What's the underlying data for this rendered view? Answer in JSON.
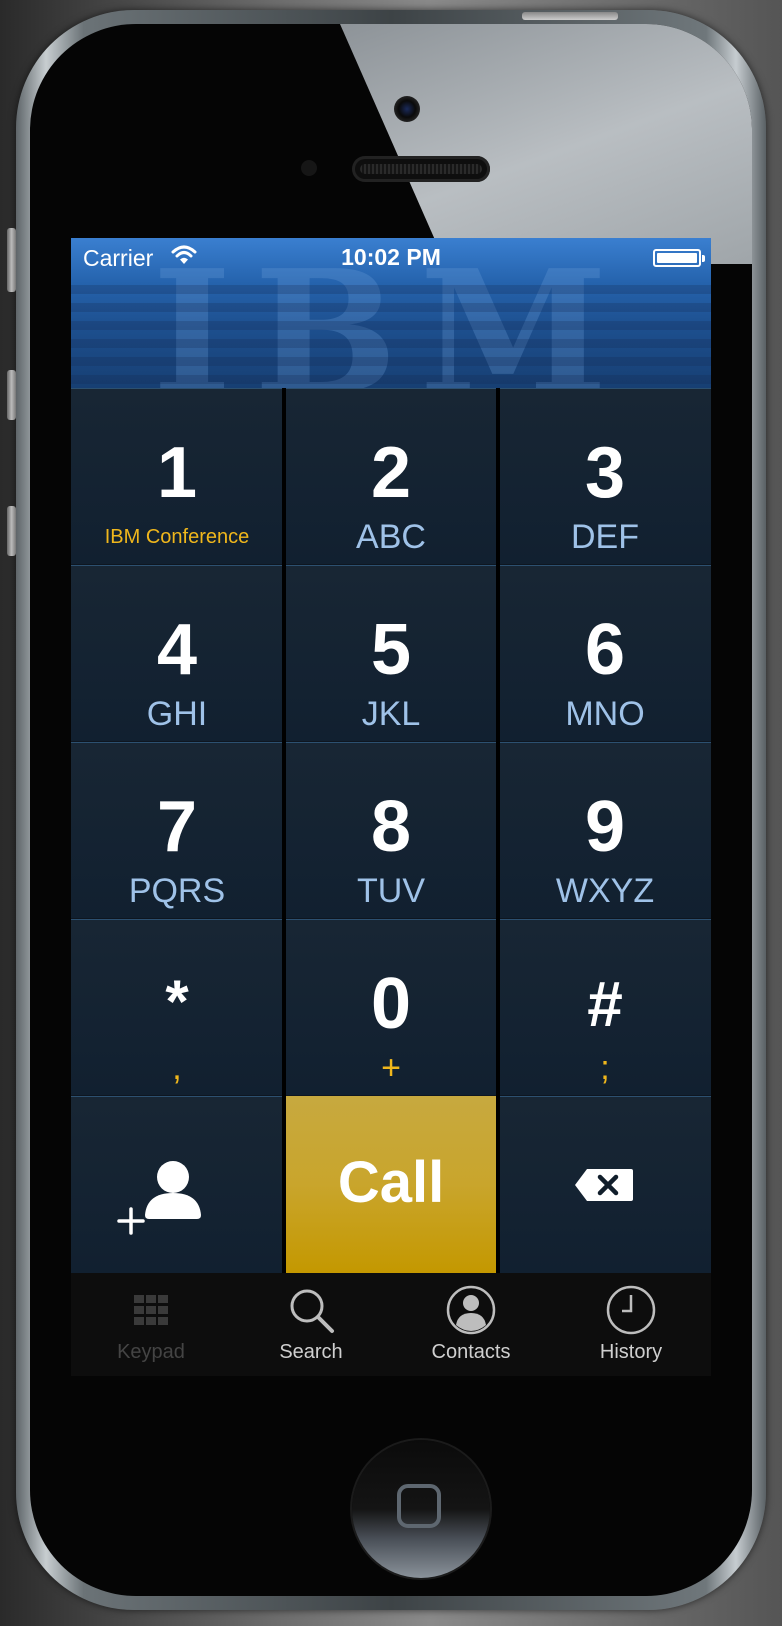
{
  "status_bar": {
    "carrier": "Carrier",
    "time": "10:02 PM",
    "wifi_icon": "wifi-icon",
    "battery_icon": "battery-icon"
  },
  "header": {
    "logo_text": "IBM",
    "background_color": "#2563ad"
  },
  "keypad": {
    "keys": [
      {
        "digit": "1",
        "sub": "IBM Conference"
      },
      {
        "digit": "2",
        "sub": "ABC"
      },
      {
        "digit": "3",
        "sub": "DEF"
      },
      {
        "digit": "4",
        "sub": "GHI"
      },
      {
        "digit": "5",
        "sub": "JKL"
      },
      {
        "digit": "6",
        "sub": "MNO"
      },
      {
        "digit": "7",
        "sub": "PQRS"
      },
      {
        "digit": "8",
        "sub": "TUV"
      },
      {
        "digit": "9",
        "sub": "WXYZ"
      },
      {
        "digit": "*",
        "sub": ","
      },
      {
        "digit": "0",
        "sub": "+"
      },
      {
        "digit": "#",
        "sub": ";"
      }
    ],
    "add_contact_icon": "add-contact-icon",
    "call_label": "Call",
    "call_color": "#c9a52c",
    "backspace_icon": "backspace-icon",
    "accent_text_color": "#f0b71c",
    "letters_color": "#9fc2e8"
  },
  "tabbar": {
    "tabs": [
      {
        "label": "Keypad",
        "icon": "keypad-grid-icon",
        "active": false
      },
      {
        "label": "Search",
        "icon": "search-icon",
        "active": true
      },
      {
        "label": "Contacts",
        "icon": "contacts-icon",
        "active": true
      },
      {
        "label": "History",
        "icon": "clock-icon",
        "active": true
      }
    ]
  }
}
